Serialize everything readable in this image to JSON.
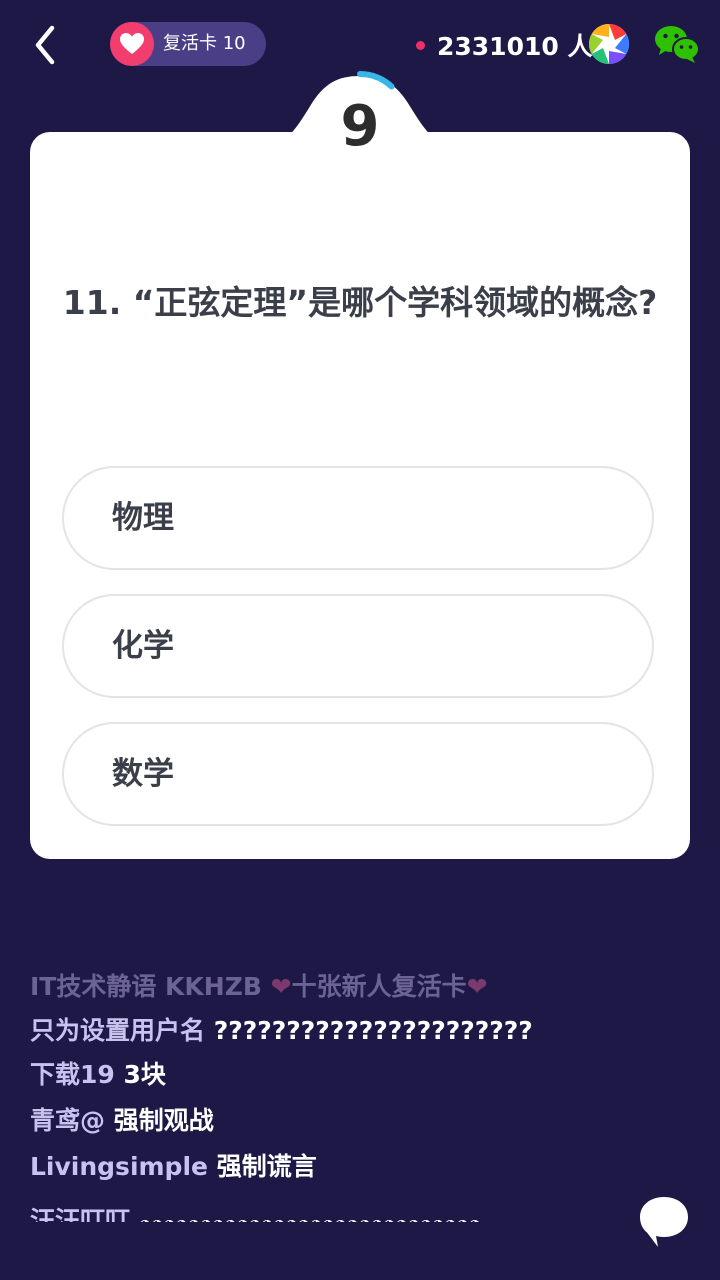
{
  "topbar": {
    "revive_label": "复活卡 10",
    "viewer_count": "2331010 人",
    "colors": {
      "heart": "#f23d6f",
      "pill": "#4a3f86",
      "dot": "#ee2f6a"
    }
  },
  "timer": {
    "value": "9",
    "progress": 0.12,
    "color": "#38b6e8"
  },
  "question": {
    "text": "11. “正弦定理”是哪个学科领域的概念?",
    "options": [
      "物理",
      "化学",
      "数学"
    ]
  },
  "chat": [
    {
      "user": "IT技术静语 KKHZB",
      "message": "十张新人复活卡"
    },
    {
      "user": "只为设置用户名",
      "message": "??????????????????????"
    },
    {
      "user": "下载19",
      "message": "3块"
    },
    {
      "user": "青鸢@",
      "message": "强制观战"
    },
    {
      "user": "Livingsimple",
      "message": "强制谎言"
    },
    {
      "user": "汪汪叮叮",
      "message": "◕◕◕◕◕◕◕◕◕◕◕◕◕◕◕◕◕◕◕◕◕◕◕◕◕◕◕◕"
    }
  ],
  "theme": {
    "background": "#1e1846",
    "card": "#ffffff",
    "text_dark": "#3a3f4a"
  }
}
